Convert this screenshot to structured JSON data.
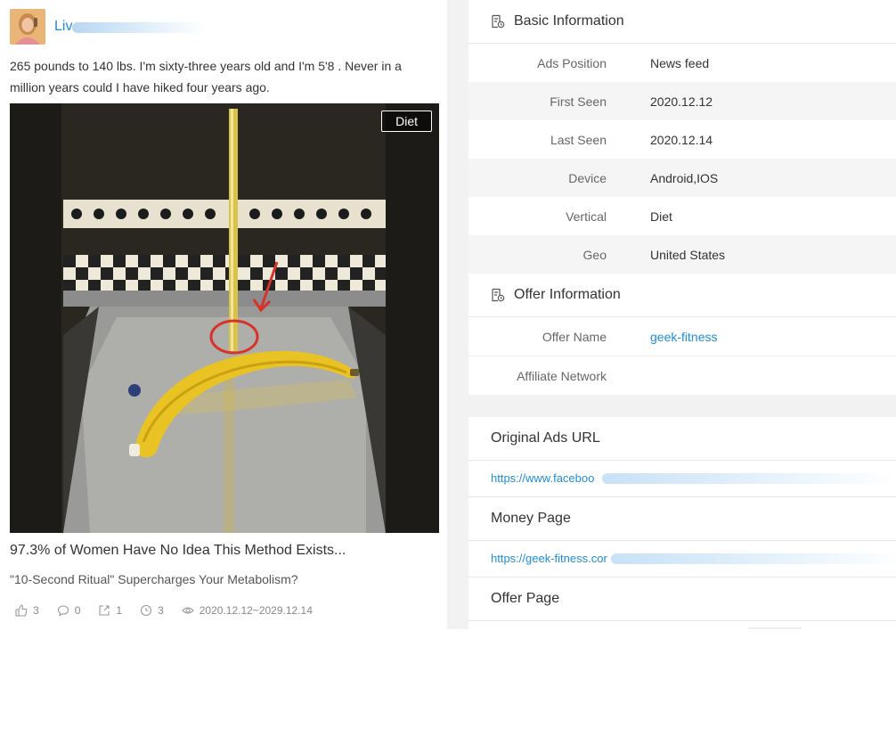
{
  "ad": {
    "author_name": "Liv",
    "caption": "265 pounds to 140 lbs. I'm sixty-three years old and I'm 5'8 . Never in a million years could I have hiked four years ago.",
    "vertical_tag": "Diet",
    "headline": "97.3% of Women Have No Idea This Method Exists...",
    "subline": "\"10-Second Ritual\" Supercharges Your Metabolism?",
    "stats": {
      "likes": "3",
      "comments": "0",
      "shares": "1",
      "days": "3",
      "date_range": "2020.12.12~2029.12.14"
    }
  },
  "basic_info": {
    "title": "Basic Information",
    "rows": [
      {
        "label": "Ads Position",
        "value": "News feed"
      },
      {
        "label": "First Seen",
        "value": "2020.12.12"
      },
      {
        "label": "Last Seen",
        "value": "2020.12.14"
      },
      {
        "label": "Device",
        "value": "Android,IOS"
      },
      {
        "label": "Vertical",
        "value": "Diet"
      },
      {
        "label": "Geo",
        "value": "United States"
      }
    ]
  },
  "offer_info": {
    "title": "Offer Information",
    "rows": [
      {
        "label": "Offer Name",
        "value": "geek-fitness"
      },
      {
        "label": "Affiliate Network",
        "value": ""
      }
    ]
  },
  "urls": {
    "original_title": "Original Ads URL",
    "original_url": "https://www.faceboo",
    "money_title": "Money Page",
    "money_url": "https://geek-fitness.cor",
    "offer_title": "Offer Page"
  },
  "colors": {
    "link": "#1e8ed8",
    "alt_row": "#f5f5f5",
    "gutter": "#f2f2f2"
  }
}
